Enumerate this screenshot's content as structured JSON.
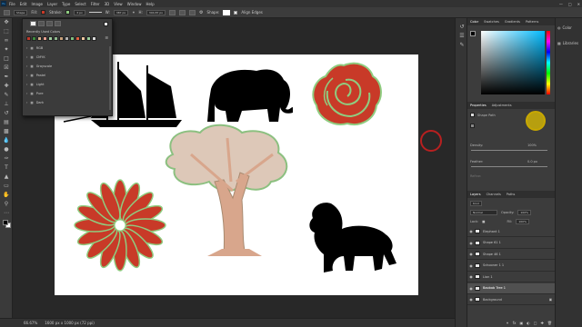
{
  "menubar": {
    "logo": "Ps",
    "items": [
      "File",
      "Edit",
      "Image",
      "Layer",
      "Type",
      "Select",
      "Filter",
      "3D",
      "View",
      "Window",
      "Help"
    ]
  },
  "options_bar": {
    "mode": "Shape",
    "fill_label": "Fill:",
    "stroke_label": "Stroke:",
    "stroke_width": "3 px",
    "w_label": "W:",
    "w_value": "387 px",
    "h_label": "H:",
    "h_value": "304.87 px",
    "shape_label": "Shape:",
    "align_edges": "Align Edges"
  },
  "swatches_panel": {
    "title": "Recently Used Colors",
    "recent_colors": [
      "#c0392b",
      "#3d8b3d",
      "#d6b08c",
      "#e8a090",
      "#a0d0a0",
      "#8fb98f",
      "#c8a07a",
      "#b0b0b0",
      "#7fbf7f",
      "#e06040",
      "#f0c8a0",
      "#9ad09a",
      "#d9d9d9"
    ],
    "folders": [
      "RGB",
      "CMYK",
      "Grayscale",
      "Pastel",
      "Light",
      "Pure",
      "Dark"
    ]
  },
  "color_panel": {
    "tabs": [
      "Color",
      "Swatches",
      "Gradients",
      "Patterns"
    ]
  },
  "properties_panel": {
    "tabs": [
      "Properties",
      "Adjustments"
    ],
    "type": "Shape Path",
    "density_label": "Density:",
    "density_value": "100%",
    "feather_label": "Feather:",
    "feather_value": "0.0 px",
    "refine_label": "Refine:",
    "select_mask": "Select and Mask..."
  },
  "layers_panel": {
    "tabs": [
      "Layers",
      "Channels",
      "Paths"
    ],
    "filter_kind": "Kind",
    "blend_mode": "Normal",
    "opacity_label": "Opacity:",
    "opacity_value": "100%",
    "lock_label": "Lock:",
    "fill_label": "Fill:",
    "fill_value": "100%",
    "layers": [
      {
        "name": "Elephant 1",
        "selected": false
      },
      {
        "name": "Shape 61 1",
        "selected": false
      },
      {
        "name": "Shape 46 1",
        "selected": false
      },
      {
        "name": "Schooner 1 1",
        "selected": false
      },
      {
        "name": "Lion 1",
        "selected": false
      },
      {
        "name": "Baobab Tree 1",
        "selected": true
      },
      {
        "name": "Background",
        "selected": false
      }
    ]
  },
  "far_right": {
    "items": [
      "Color",
      "Libraries"
    ]
  },
  "statusbar": {
    "zoom": "66.67%",
    "doc_size": "1600 px x 1000 px (72 ppi)"
  },
  "colors": {
    "flower_red": "#c83a28",
    "stroke_green": "#8fcc80",
    "trunk": "#d8a68c",
    "canopy_stroke": "#8cc080",
    "accent_cursor": "#e0c000"
  }
}
